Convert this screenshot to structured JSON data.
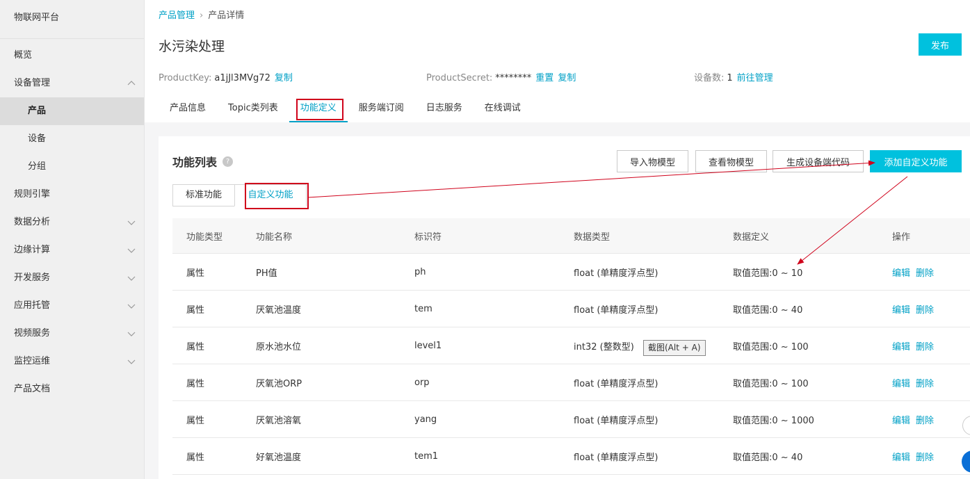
{
  "sidebar": {
    "title": "物联网平台",
    "items": [
      {
        "label": "概览"
      },
      {
        "label": "设备管理"
      },
      {
        "label": "产品"
      },
      {
        "label": "设备"
      },
      {
        "label": "分组"
      },
      {
        "label": "规则引擎"
      },
      {
        "label": "数据分析"
      },
      {
        "label": "边缘计算"
      },
      {
        "label": "开发服务"
      },
      {
        "label": "应用托管"
      },
      {
        "label": "视频服务"
      },
      {
        "label": "监控运维"
      },
      {
        "label": "产品文档"
      }
    ]
  },
  "breadcrumb": {
    "parent": "产品管理",
    "separator": "›",
    "current": "产品详情"
  },
  "product": {
    "name": "水污染处理",
    "publish_label": "发布",
    "product_key_label": "ProductKey:",
    "product_key": "a1jJl3MVg72",
    "copy_label": "复制",
    "secret_label": "ProductSecret:",
    "secret": "********",
    "reset_label": "重置",
    "device_count_label": "设备数:",
    "device_count": "1",
    "manage_label": "前往管理"
  },
  "tabs": [
    "产品信息",
    "Topic类列表",
    "功能定义",
    "服务端订阅",
    "日志服务",
    "在线调试"
  ],
  "panel": {
    "title": "功能列表",
    "help": "?",
    "buttons": {
      "import": "导入物模型",
      "view": "查看物模型",
      "generate": "生成设备端代码",
      "add": "添加自定义功能"
    },
    "subtabs": {
      "standard": "标准功能",
      "custom": "自定义功能"
    }
  },
  "table": {
    "headers": [
      "功能类型",
      "功能名称",
      "标识符",
      "数据类型",
      "数据定义",
      "操作"
    ],
    "actions": {
      "edit": "编辑",
      "delete": "删除"
    },
    "rows": [
      [
        "属性",
        "PH值",
        "ph",
        "float (单精度浮点型)",
        "取值范围:0 ~ 10"
      ],
      [
        "属性",
        "厌氧池温度",
        "tem",
        "float (单精度浮点型)",
        "取值范围:0 ~ 40"
      ],
      [
        "属性",
        "原水池水位",
        "level1",
        "int32 (整数型)",
        "取值范围:0 ~ 100"
      ],
      [
        "属性",
        "厌氧池ORP",
        "orp",
        "float (单精度浮点型)",
        "取值范围:0 ~ 100"
      ],
      [
        "属性",
        "厌氧池溶氧",
        "yang",
        "float (单精度浮点型)",
        "取值范围:0 ~ 1000"
      ],
      [
        "属性",
        "好氧池温度",
        "tem1",
        "float (单精度浮点型)",
        "取值范围:0 ~ 40"
      ]
    ]
  },
  "overlay": {
    "screenshot_tip": "截图(Alt + A)"
  },
  "colors": {
    "accent": "#00c1de",
    "link": "#00a0c6",
    "highlight": "#d0021b"
  }
}
